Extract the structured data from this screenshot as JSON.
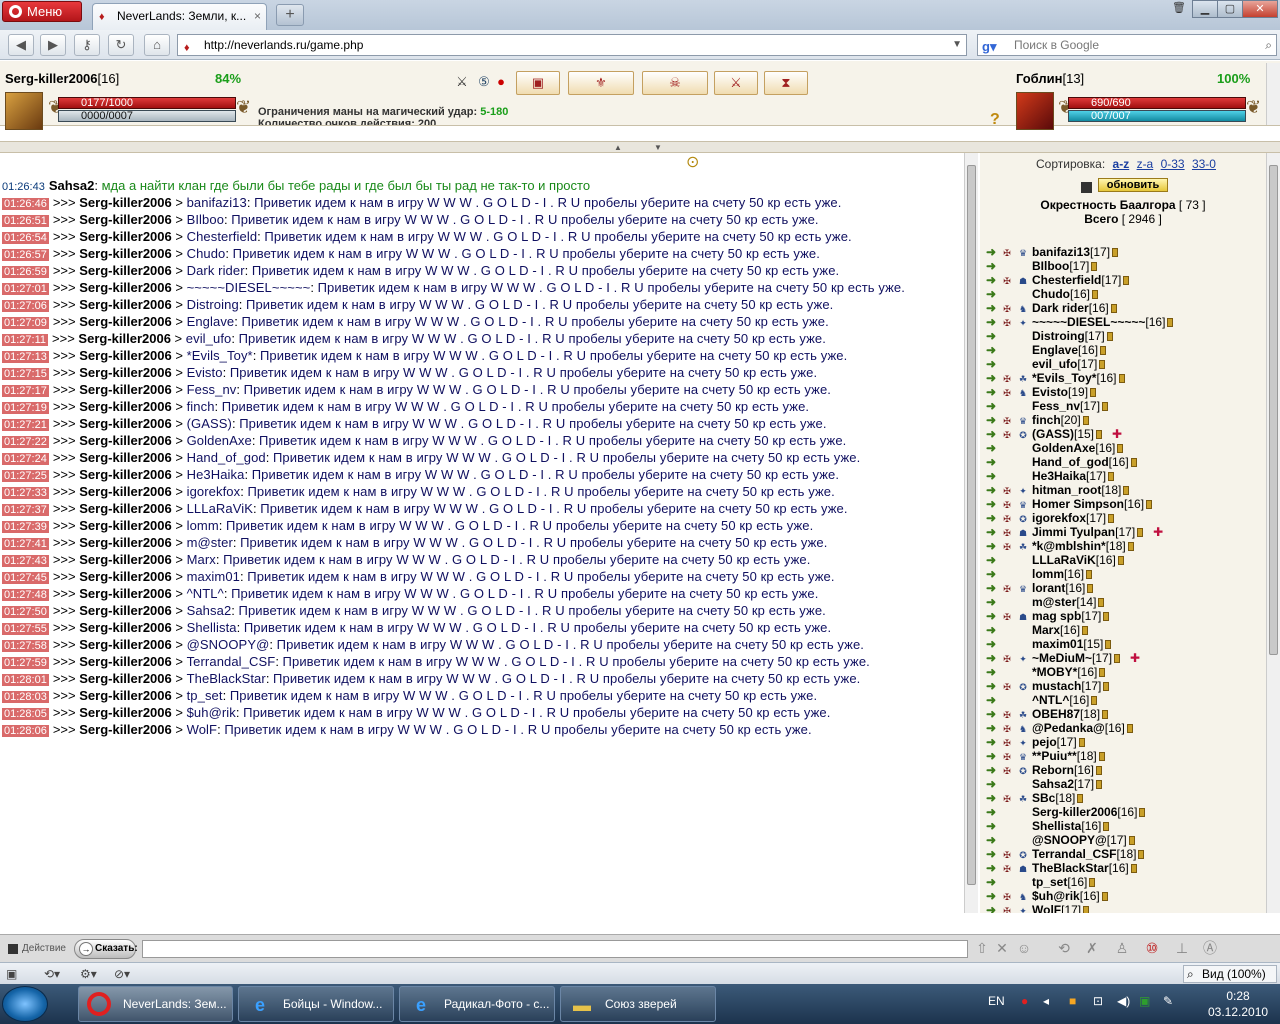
{
  "browser": {
    "menu_label": "Меню",
    "tab_title": "NeverLands: Земли, к...",
    "tab_close": "×",
    "new_tab": "+",
    "url": "http://neverlands.ru/game.php",
    "search_placeholder": "Поиск в Google",
    "zoom_label": "Вид (100%)"
  },
  "player": {
    "name": "Serg-killer2006",
    "level": "[16]",
    "hp_percent": "84%",
    "hp": "0177/1000",
    "mana": "0000/0007"
  },
  "enemy": {
    "name": "Гоблин",
    "level": "[13]",
    "hp_percent": "100%",
    "hp": "690/690",
    "mana": "007/007"
  },
  "battle_info": {
    "mana_limit_label": "Ограничения маны на магический удар:",
    "mana_limit_value": "5-180",
    "action_points": "Количество очков действия: 200"
  },
  "chat": {
    "first": {
      "time": "01:26:43",
      "sender": "Sahsa2",
      "text": "мда а найти клан где были бы тебе рады и где был бы ты рад не так-то и просто"
    },
    "sender": "Serg-killer2006",
    "prefix": ">>>",
    "body": "Приветик идем к нам в игру W W W . G O L D - I . R U пробелы уберите на счету 50 кр есть уже.",
    "lines": [
      {
        "time": "01:26:46",
        "to": "banifazi13"
      },
      {
        "time": "01:26:51",
        "to": "BIlboo"
      },
      {
        "time": "01:26:54",
        "to": "Chesterfield"
      },
      {
        "time": "01:26:57",
        "to": "Chudo"
      },
      {
        "time": "01:26:59",
        "to": "Dark rider"
      },
      {
        "time": "01:27:01",
        "to": "~~~~~DIESEL~~~~~"
      },
      {
        "time": "01:27:06",
        "to": "Distroing"
      },
      {
        "time": "01:27:09",
        "to": "Englave"
      },
      {
        "time": "01:27:11",
        "to": "evil_ufo"
      },
      {
        "time": "01:27:13",
        "to": "*Evils_Toy*"
      },
      {
        "time": "01:27:15",
        "to": "Evisto"
      },
      {
        "time": "01:27:17",
        "to": "Fess_nv"
      },
      {
        "time": "01:27:19",
        "to": "finch"
      },
      {
        "time": "01:27:21",
        "to": "(GASS)"
      },
      {
        "time": "01:27:22",
        "to": "GoldenAxe"
      },
      {
        "time": "01:27:24",
        "to": "Hand_of_god"
      },
      {
        "time": "01:27:25",
        "to": "He3Haika"
      },
      {
        "time": "01:27:33",
        "to": "igorekfox"
      },
      {
        "time": "01:27:37",
        "to": "LLLaRaViK"
      },
      {
        "time": "01:27:39",
        "to": "lomm"
      },
      {
        "time": "01:27:41",
        "to": "m@ster"
      },
      {
        "time": "01:27:43",
        "to": "Marx"
      },
      {
        "time": "01:27:45",
        "to": "maxim01"
      },
      {
        "time": "01:27:48",
        "to": "^NTL^"
      },
      {
        "time": "01:27:50",
        "to": "Sahsa2"
      },
      {
        "time": "01:27:55",
        "to": "Shellista"
      },
      {
        "time": "01:27:58",
        "to": "@SNOOPY@"
      },
      {
        "time": "01:27:59",
        "to": "Terrandal_CSF"
      },
      {
        "time": "01:28:01",
        "to": "TheBlackStar"
      },
      {
        "time": "01:28:03",
        "to": "tp_set"
      },
      {
        "time": "01:28:05",
        "to": "$uh@rik"
      },
      {
        "time": "01:28:06",
        "to": "WolF"
      }
    ]
  },
  "right_panel": {
    "sort_label": "Сортировка:",
    "sort_options": [
      "a-z",
      "z-a",
      "0-33",
      "33-0"
    ],
    "refresh_label": "обновить",
    "location_label": "Окрестность Баалгора",
    "location_count": "[ 73 ]",
    "total_label": "Всего",
    "total_count": "[ 2946 ]",
    "players": [
      {
        "name": "banifazi13",
        "level": "[17]",
        "clan": true
      },
      {
        "name": "BIlboo",
        "level": "[17]",
        "clan": false
      },
      {
        "name": "Chesterfield",
        "level": "[17]",
        "clan": true
      },
      {
        "name": "Chudo",
        "level": "[16]",
        "clan": false
      },
      {
        "name": "Dark rider",
        "level": "[16]",
        "clan": true
      },
      {
        "name": "~~~~~DIESEL~~~~~",
        "level": "[16]",
        "clan": true
      },
      {
        "name": "Distroing",
        "level": "[17]",
        "clan": false
      },
      {
        "name": "Englave",
        "level": "[16]",
        "clan": false
      },
      {
        "name": "evil_ufo",
        "level": "[17]",
        "clan": false
      },
      {
        "name": "*Evils_Toy*",
        "level": "[16]",
        "clan": true
      },
      {
        "name": "Evisto",
        "level": "[19]",
        "clan": true
      },
      {
        "name": "Fess_nv",
        "level": "[17]",
        "clan": false
      },
      {
        "name": "finch",
        "level": "[20]",
        "clan": true
      },
      {
        "name": "(GASS)",
        "level": "[15]",
        "clan": true,
        "trauma": true
      },
      {
        "name": "GoldenAxe",
        "level": "[16]",
        "clan": false
      },
      {
        "name": "Hand_of_god",
        "level": "[16]",
        "clan": false
      },
      {
        "name": "He3Haika",
        "level": "[17]",
        "clan": false
      },
      {
        "name": "hitman_root",
        "level": "[18]",
        "clan": true
      },
      {
        "name": "Homer Simpson",
        "level": "[16]",
        "clan": true
      },
      {
        "name": "igorekfox",
        "level": "[17]",
        "clan": true
      },
      {
        "name": "Jimmi Tyulpan",
        "level": "[17]",
        "clan": true,
        "trauma": true
      },
      {
        "name": "*k@mblshin*",
        "level": "[18]",
        "clan": true
      },
      {
        "name": "LLLaRaViK",
        "level": "[16]",
        "clan": false
      },
      {
        "name": "lomm",
        "level": "[16]",
        "clan": false
      },
      {
        "name": "lorant",
        "level": "[16]",
        "clan": true
      },
      {
        "name": "m@ster",
        "level": "[14]",
        "clan": false
      },
      {
        "name": "mag spb",
        "level": "[17]",
        "clan": true
      },
      {
        "name": "Marx",
        "level": "[16]",
        "clan": false
      },
      {
        "name": "maxim01",
        "level": "[15]",
        "clan": false
      },
      {
        "name": "~MeDiuM~",
        "level": "[17]",
        "clan": true,
        "trauma": true
      },
      {
        "name": "*MOBY*",
        "level": "[16]",
        "clan": false
      },
      {
        "name": "mustach",
        "level": "[17]",
        "clan": true
      },
      {
        "name": "^NTL^",
        "level": "[16]",
        "clan": false
      },
      {
        "name": "OBEH87",
        "level": "[18]",
        "clan": true
      },
      {
        "name": "@Pedanka@",
        "level": "[16]",
        "clan": true
      },
      {
        "name": "pejo",
        "level": "[17]",
        "clan": true
      },
      {
        "name": "**Puiu**",
        "level": "[18]",
        "clan": true
      },
      {
        "name": "Reborn",
        "level": "[16]",
        "clan": true
      },
      {
        "name": "Sahsa2",
        "level": "[17]",
        "clan": false
      },
      {
        "name": "SBc",
        "level": "[18]",
        "clan": true
      },
      {
        "name": "Serg-killer2006",
        "level": "[16]",
        "clan": false
      },
      {
        "name": "Shellista",
        "level": "[16]",
        "clan": false
      },
      {
        "name": "@SNOOPY@",
        "level": "[17]",
        "clan": false
      },
      {
        "name": "Terrandal_CSF",
        "level": "[18]",
        "clan": true
      },
      {
        "name": "TheBlackStar",
        "level": "[16]",
        "clan": true
      },
      {
        "name": "tp_set",
        "level": "[16]",
        "clan": false
      },
      {
        "name": "$uh@rik",
        "level": "[16]",
        "clan": true
      },
      {
        "name": "WolF",
        "level": "[17]",
        "clan": true
      }
    ]
  },
  "input": {
    "action_label": "Действие",
    "say_label": "Сказать:"
  },
  "taskbar": {
    "tasks": [
      "NeverLands: Зем...",
      "Бойцы - Window...",
      "Радикал-Фото - с...",
      "Союз зверей"
    ],
    "lang": "EN",
    "time": "0:28",
    "date": "03.12.2010"
  },
  "colors": {
    "timestamp_bg": "#d96a6a",
    "hp_pct": "#1a9e1a",
    "link": "#1a3ea0"
  }
}
